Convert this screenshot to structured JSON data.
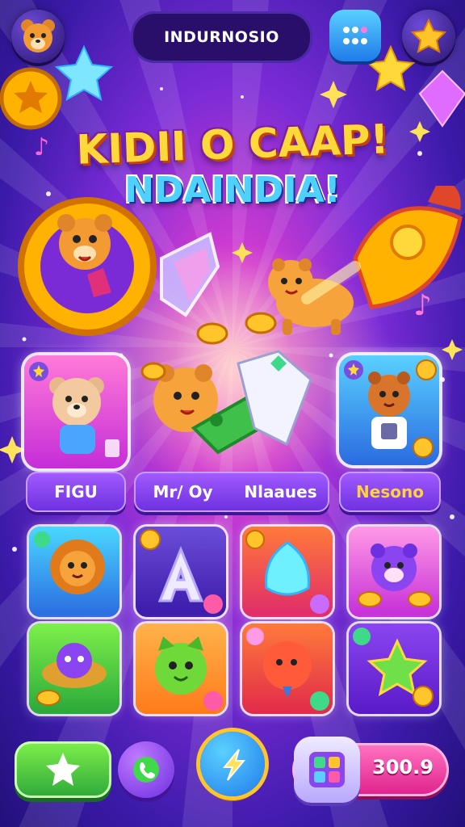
{
  "colors": {
    "background": "#7a2bd6",
    "accent_yellow": "#ffd93a",
    "accent_cyan": "#4fd1ff",
    "pill_purple": "#8a45f0",
    "score_pink": "#ff4fb0",
    "play_green": "#3fd94a"
  },
  "topbar": {
    "title": "INDURNOSIO",
    "avatar_icon": "bear-face-icon",
    "menu_icon": "grid-dots-icon",
    "star_icon": "star-icon"
  },
  "headline": {
    "line1": "KIDII O CAAP!",
    "line2": "NDAINDIA!"
  },
  "cards": {
    "labels": [
      "FIGU",
      "Mr/ Oy",
      "Nlaaues",
      "Nesono"
    ]
  },
  "bottom": {
    "play_icon": "star-icon",
    "friend_icon": "phone-icon",
    "boost_icon": "lightning-icon",
    "inventory_icon": "gift-box-icon",
    "score": "300.9"
  }
}
